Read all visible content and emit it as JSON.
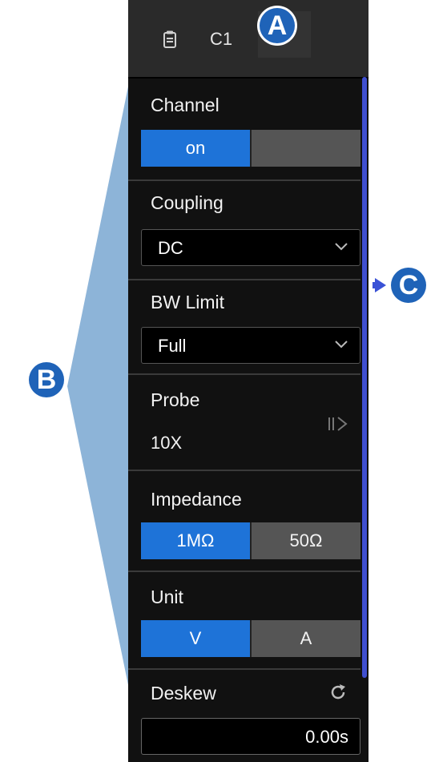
{
  "callouts": {
    "a": "A",
    "b": "B",
    "c": "C"
  },
  "header": {
    "title": "C1",
    "icon": "document-icon"
  },
  "channel": {
    "label": "Channel",
    "options": [
      "on",
      ""
    ],
    "active": 0
  },
  "coupling": {
    "label": "Coupling",
    "value": "DC"
  },
  "bw_limit": {
    "label": "BW Limit",
    "value": "Full"
  },
  "probe": {
    "label": "Probe",
    "value": "10X",
    "icon": "probe-expand-icon"
  },
  "impedance": {
    "label": "Impedance",
    "options": [
      "1MΩ",
      "50Ω"
    ],
    "active": 0
  },
  "unit": {
    "label": "Unit",
    "options": [
      "V",
      "A"
    ],
    "active": 0
  },
  "deskew": {
    "label": "Deskew",
    "value": "0.00s",
    "icon": "reset-icon"
  },
  "colors": {
    "accent": "#1e73d8",
    "panel_bg": "#111111",
    "inactive_option": "#555555",
    "scrollbar": "#3f4fd0",
    "callout_badge": "#1f63b8",
    "wedge": "#8db4d8"
  }
}
